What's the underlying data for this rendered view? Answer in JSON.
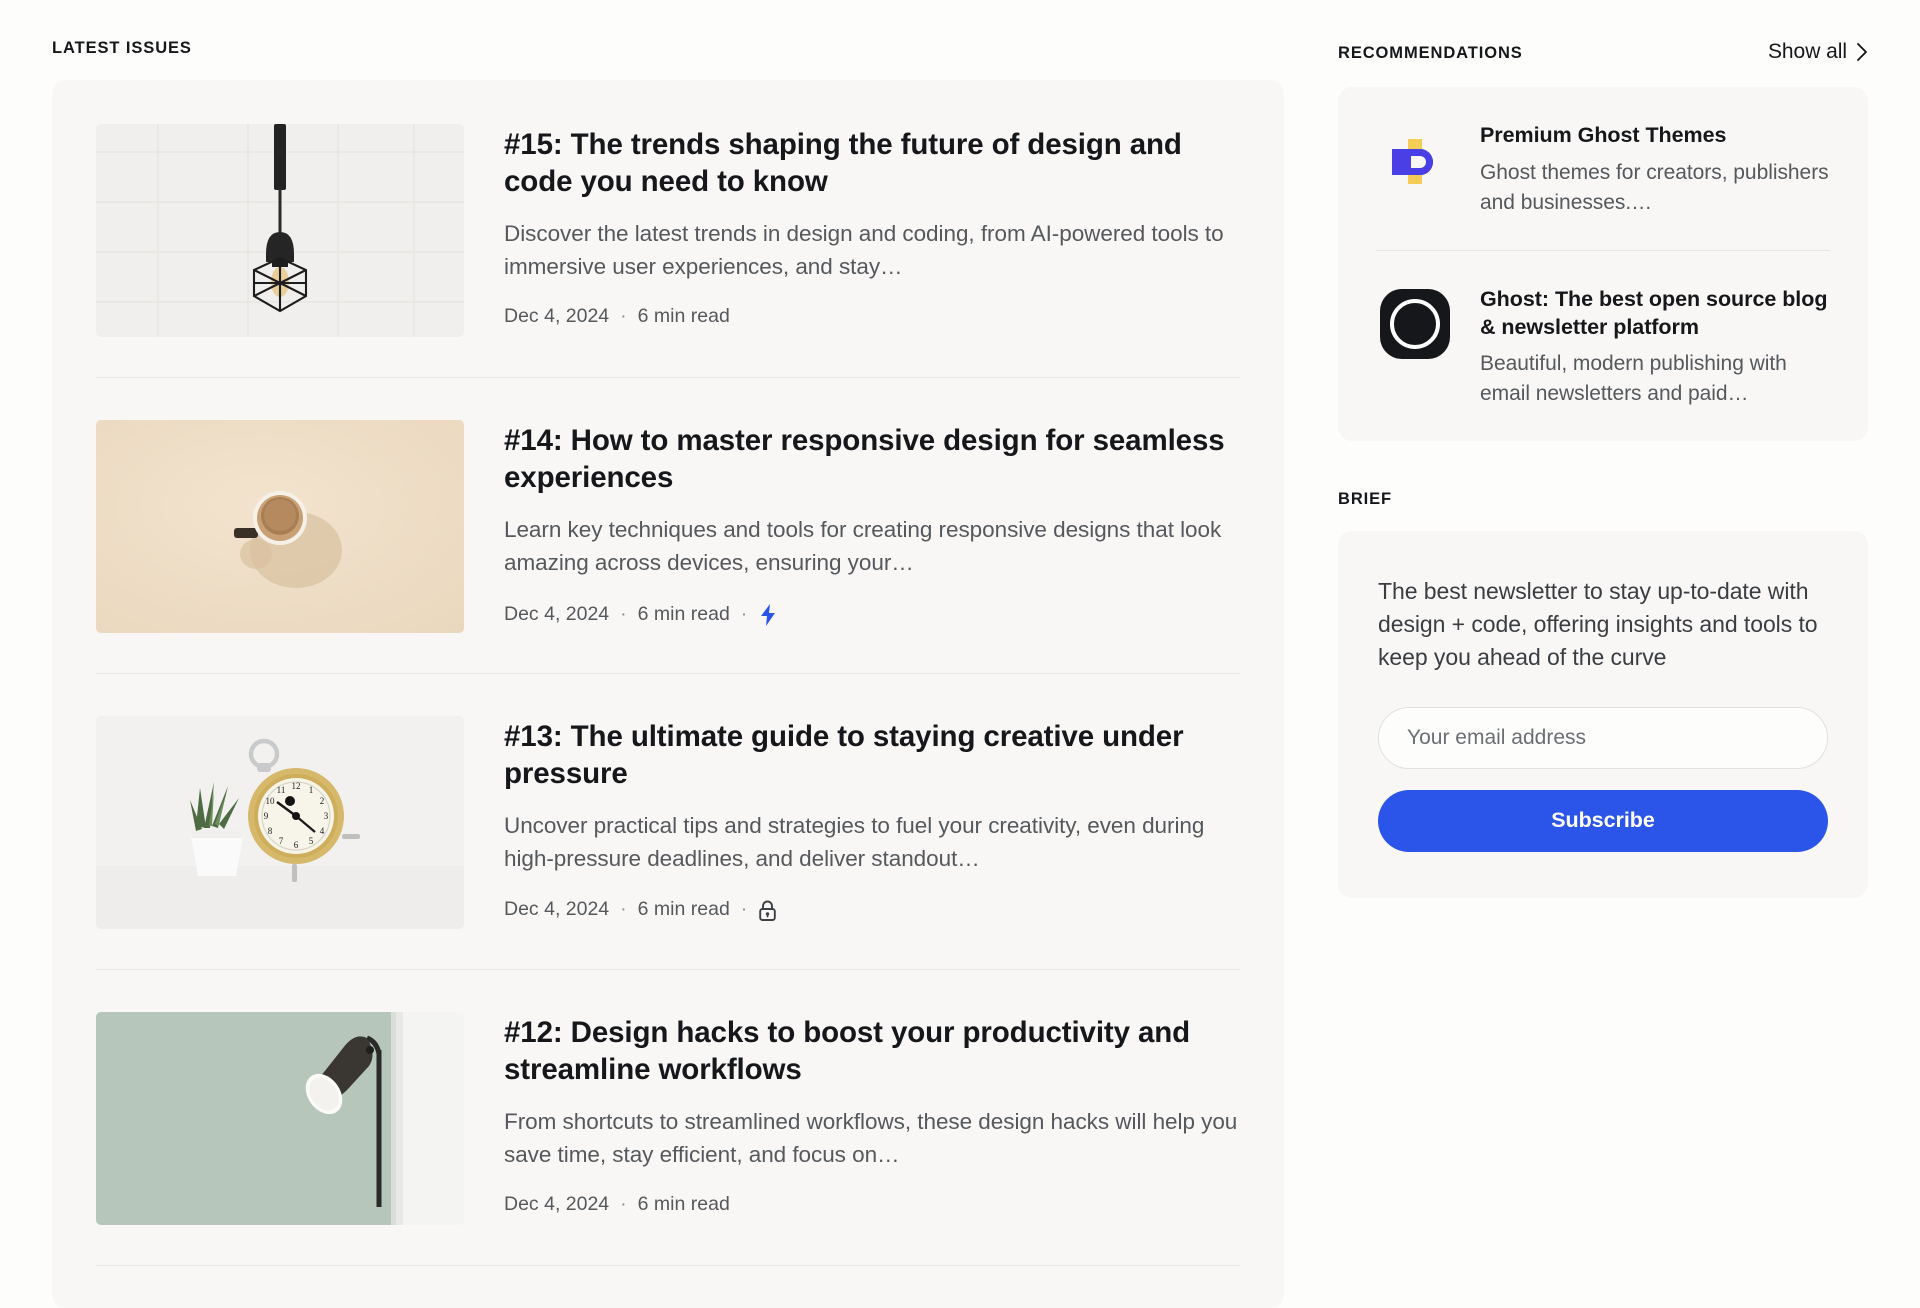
{
  "left": {
    "section_label": "LATEST ISSUES",
    "issues": [
      {
        "title": "#15: The trends shaping the future of design and code you need to know",
        "excerpt": "Discover the latest trends in design and coding, from AI-powered tools to immersive user experiences, and stay…",
        "date": "Dec 4, 2024",
        "read_time": "6 min read",
        "badge": "none",
        "thumb_name": "pendant-lamp-white-tile-photo"
      },
      {
        "title": "#14: How to master responsive design for seamless experiences",
        "excerpt": "Learn key techniques and tools for creating responsive designs that look amazing across devices, ensuring your…",
        "date": "Dec 4, 2024",
        "read_time": "6 min read",
        "badge": "bolt",
        "thumb_name": "coffee-cup-beige-photo"
      },
      {
        "title": "#13: The ultimate guide to staying creative under pressure",
        "excerpt": "Uncover practical tips and strategies to fuel your creativity, even during high-pressure deadlines, and deliver standout…",
        "date": "Dec 4, 2024",
        "read_time": "6 min read",
        "badge": "lock",
        "thumb_name": "clock-and-plant-photo"
      },
      {
        "title": "#12: Design hacks to boost your productivity and streamline workflows",
        "excerpt": "From shortcuts to streamlined workflows, these design hacks will help you save time, stay efficient, and focus on…",
        "date": "Dec 4, 2024",
        "read_time": "6 min read",
        "badge": "none",
        "thumb_name": "desk-lamp-green-wall-photo"
      }
    ],
    "meta_separator": "·"
  },
  "right": {
    "recommendations_label": "RECOMMENDATIONS",
    "show_all_label": "Show all",
    "recommendations": [
      {
        "title": "Premium Ghost Themes",
        "description": "Ghost themes for creators, publishers and businesses.…",
        "logo_name": "premium-ghost-themes-logo"
      },
      {
        "title": "Ghost: The best open source blog & newsletter platform",
        "description": "Beautiful, modern publishing with email newsletters and paid…",
        "logo_name": "ghost-logo"
      }
    ],
    "brief_label": "BRIEF",
    "brief_text": "The best newsletter to stay up-to-date with design + code, offering insights and tools to keep you ahead of the curve",
    "email_placeholder": "Your email address",
    "subscribe_label": "Subscribe"
  },
  "colors": {
    "page_bg": "#fdfdfc",
    "card_bg": "#f8f7f5",
    "accent_blue": "#2b54e8",
    "text_primary": "#15171a",
    "text_secondary": "#55585c",
    "divider": "#e9e7e2",
    "logo_yellow": "#f5cd56",
    "logo_purple": "#4a3fe4"
  }
}
